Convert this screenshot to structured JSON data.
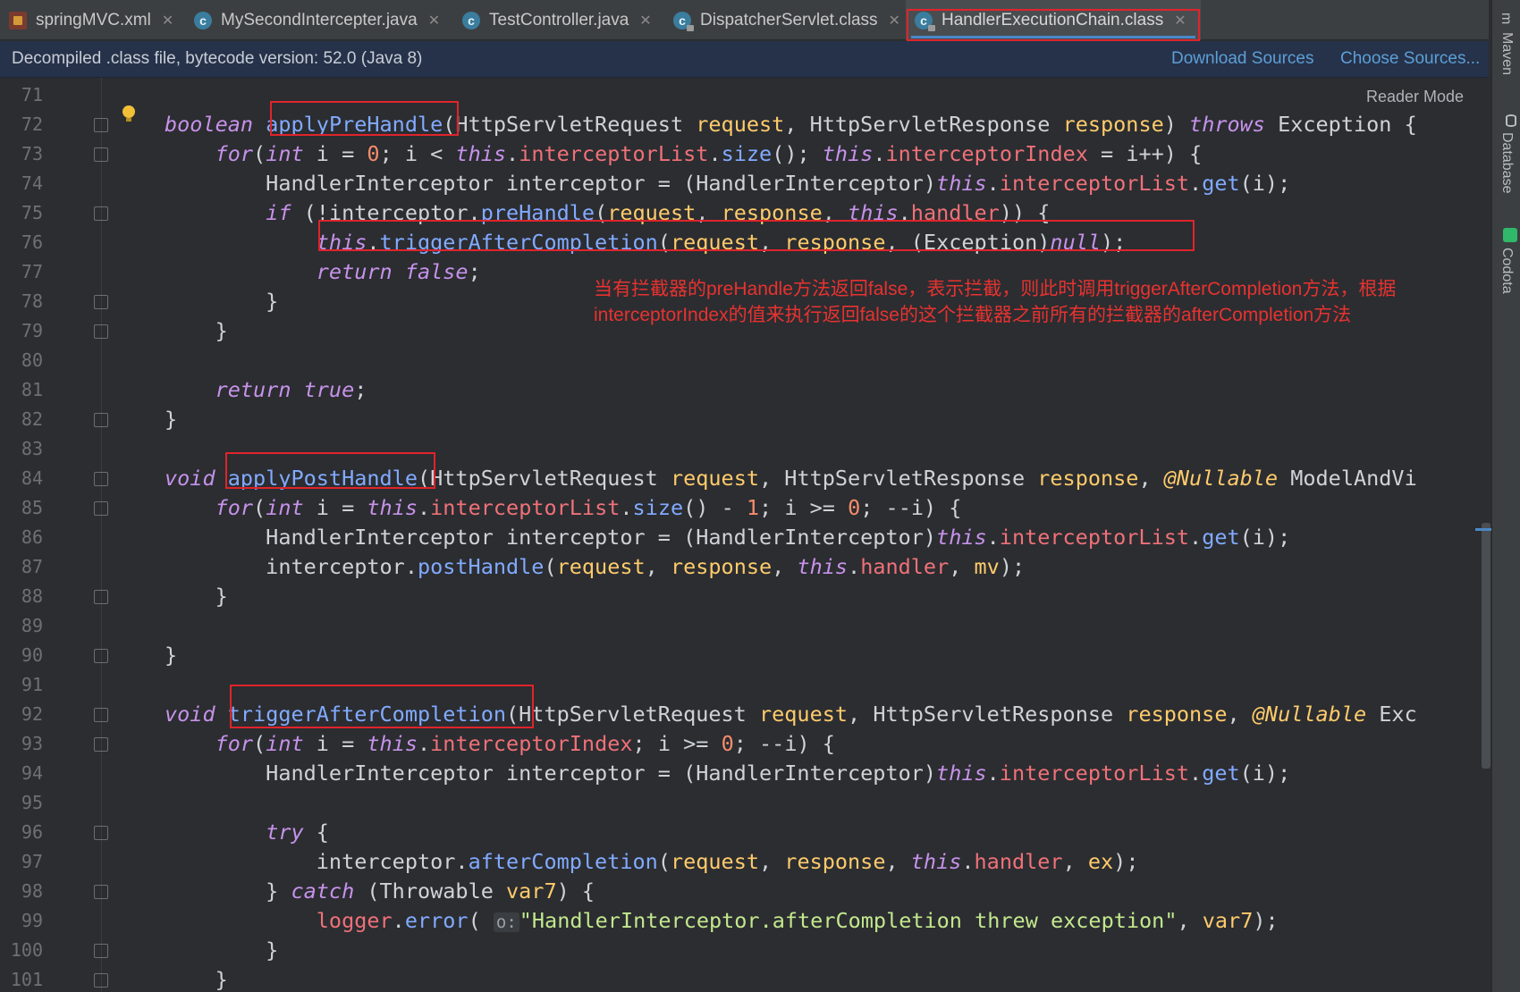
{
  "tabs": [
    {
      "label": "springMVC.xml",
      "icon": "xml-file-icon",
      "active": false
    },
    {
      "label": "MySecondIntercepter.java",
      "icon": "class-icon",
      "active": false
    },
    {
      "label": "TestController.java",
      "icon": "class-icon",
      "active": false
    },
    {
      "label": "DispatcherServlet.class",
      "icon": "locked-class-icon",
      "active": false
    },
    {
      "label": "HandlerExecutionChain.class",
      "icon": "locked-class-icon",
      "active": true
    }
  ],
  "info_bar": {
    "text": "Decompiled .class file, bytecode version: 52.0 (Java 8)",
    "download_sources": "Download Sources",
    "choose_sources": "Choose Sources..."
  },
  "reader_mode": "Reader Mode",
  "annotation_note": "当有拦截器的preHandle方法返回false，表示拦截，则此时调用triggerAfterCompletion方法，根据\ninterceptorIndex的值来执行返回false的这个拦截器之前所有的拦截器的afterCompletion方法",
  "side_panels": [
    "Maven",
    "Database",
    "Codota"
  ],
  "colors": {
    "highlight_box": "#e0242b",
    "note_text": "#e8322f",
    "link": "#5c9fd6",
    "accent": "#4a88c7"
  },
  "code_lines": [
    {
      "n": "71",
      "fold": false,
      "tokens": []
    },
    {
      "n": "72",
      "fold": true,
      "tokens": [
        [
          "kw",
          "boolean"
        ],
        [
          "p",
          " "
        ],
        [
          "fn",
          "applyPreHandle"
        ],
        [
          "p",
          "(HttpServletRequest "
        ],
        [
          "param",
          "request"
        ],
        [
          "p",
          ", HttpServletResponse "
        ],
        [
          "param",
          "response"
        ],
        [
          "p",
          ") "
        ],
        [
          "kw",
          "throws"
        ],
        [
          "p",
          " Exception {"
        ]
      ]
    },
    {
      "n": "73",
      "fold": true,
      "tokens": [
        [
          "p",
          "    "
        ],
        [
          "kw",
          "for"
        ],
        [
          "p",
          "("
        ],
        [
          "kw",
          "int"
        ],
        [
          "p",
          " i = "
        ],
        [
          "num",
          "0"
        ],
        [
          "p",
          "; i < "
        ],
        [
          "kw",
          "this"
        ],
        [
          "p",
          "."
        ],
        [
          "field",
          "interceptorList"
        ],
        [
          "p",
          "."
        ],
        [
          "fn",
          "size"
        ],
        [
          "p",
          "(); "
        ],
        [
          "kw",
          "this"
        ],
        [
          "p",
          "."
        ],
        [
          "field",
          "interceptorIndex"
        ],
        [
          "p",
          " = i++) {"
        ]
      ]
    },
    {
      "n": "74",
      "fold": false,
      "tokens": [
        [
          "p",
          "        HandlerInterceptor interceptor = (HandlerInterceptor)"
        ],
        [
          "kw",
          "this"
        ],
        [
          "p",
          "."
        ],
        [
          "field",
          "interceptorList"
        ],
        [
          "p",
          "."
        ],
        [
          "fn",
          "get"
        ],
        [
          "p",
          "(i);"
        ]
      ]
    },
    {
      "n": "75",
      "fold": true,
      "tokens": [
        [
          "p",
          "        "
        ],
        [
          "kw",
          "if"
        ],
        [
          "p",
          " (!interceptor."
        ],
        [
          "fn",
          "preHandle"
        ],
        [
          "p",
          "("
        ],
        [
          "param",
          "request"
        ],
        [
          "p",
          ", "
        ],
        [
          "param",
          "response"
        ],
        [
          "p",
          ", "
        ],
        [
          "kw",
          "this"
        ],
        [
          "p",
          "."
        ],
        [
          "field",
          "handler"
        ],
        [
          "p",
          ")) {"
        ]
      ]
    },
    {
      "n": "76",
      "fold": false,
      "tokens": [
        [
          "p",
          "            "
        ],
        [
          "kw",
          "this"
        ],
        [
          "p",
          "."
        ],
        [
          "fn",
          "triggerAfterCompletion"
        ],
        [
          "p",
          "("
        ],
        [
          "param",
          "request"
        ],
        [
          "p",
          ", "
        ],
        [
          "param",
          "response"
        ],
        [
          "p",
          ", (Exception)"
        ],
        [
          "kw",
          "null"
        ],
        [
          "p",
          ");"
        ]
      ]
    },
    {
      "n": "77",
      "fold": false,
      "tokens": [
        [
          "p",
          "            "
        ],
        [
          "kw",
          "return"
        ],
        [
          "p",
          " "
        ],
        [
          "kw",
          "false"
        ],
        [
          "p",
          ";"
        ]
      ]
    },
    {
      "n": "78",
      "fold": true,
      "tokens": [
        [
          "p",
          "        }"
        ]
      ]
    },
    {
      "n": "79",
      "fold": true,
      "tokens": [
        [
          "p",
          "    }"
        ]
      ]
    },
    {
      "n": "80",
      "fold": false,
      "tokens": []
    },
    {
      "n": "81",
      "fold": false,
      "tokens": [
        [
          "p",
          "    "
        ],
        [
          "kw",
          "return"
        ],
        [
          "p",
          " "
        ],
        [
          "kw",
          "true"
        ],
        [
          "p",
          ";"
        ]
      ]
    },
    {
      "n": "82",
      "fold": true,
      "tokens": [
        [
          "p",
          "}"
        ]
      ]
    },
    {
      "n": "83",
      "fold": false,
      "tokens": []
    },
    {
      "n": "84",
      "fold": true,
      "tokens": [
        [
          "kw",
          "void"
        ],
        [
          "p",
          " "
        ],
        [
          "fn",
          "applyPostHandle"
        ],
        [
          "p",
          "(HttpServletRequest "
        ],
        [
          "param",
          "request"
        ],
        [
          "p",
          ", HttpServletResponse "
        ],
        [
          "param",
          "response"
        ],
        [
          "p",
          ", "
        ],
        [
          "ann",
          "@Nullable"
        ],
        [
          "p",
          " ModelAndVi"
        ]
      ]
    },
    {
      "n": "85",
      "fold": true,
      "tokens": [
        [
          "p",
          "    "
        ],
        [
          "kw",
          "for"
        ],
        [
          "p",
          "("
        ],
        [
          "kw",
          "int"
        ],
        [
          "p",
          " i = "
        ],
        [
          "kw",
          "this"
        ],
        [
          "p",
          "."
        ],
        [
          "field",
          "interceptorList"
        ],
        [
          "p",
          "."
        ],
        [
          "fn",
          "size"
        ],
        [
          "p",
          "() - "
        ],
        [
          "num",
          "1"
        ],
        [
          "p",
          "; i >= "
        ],
        [
          "num",
          "0"
        ],
        [
          "p",
          "; --i) {"
        ]
      ]
    },
    {
      "n": "86",
      "fold": false,
      "tokens": [
        [
          "p",
          "        HandlerInterceptor interceptor = (HandlerInterceptor)"
        ],
        [
          "kw",
          "this"
        ],
        [
          "p",
          "."
        ],
        [
          "field",
          "interceptorList"
        ],
        [
          "p",
          "."
        ],
        [
          "fn",
          "get"
        ],
        [
          "p",
          "(i);"
        ]
      ]
    },
    {
      "n": "87",
      "fold": false,
      "tokens": [
        [
          "p",
          "        interceptor."
        ],
        [
          "fn",
          "postHandle"
        ],
        [
          "p",
          "("
        ],
        [
          "param",
          "request"
        ],
        [
          "p",
          ", "
        ],
        [
          "param",
          "response"
        ],
        [
          "p",
          ", "
        ],
        [
          "kw",
          "this"
        ],
        [
          "p",
          "."
        ],
        [
          "field",
          "handler"
        ],
        [
          "p",
          ", "
        ],
        [
          "param",
          "mv"
        ],
        [
          "p",
          ");"
        ]
      ]
    },
    {
      "n": "88",
      "fold": true,
      "tokens": [
        [
          "p",
          "    }"
        ]
      ]
    },
    {
      "n": "89",
      "fold": false,
      "tokens": []
    },
    {
      "n": "90",
      "fold": true,
      "tokens": [
        [
          "p",
          "}"
        ]
      ]
    },
    {
      "n": "91",
      "fold": false,
      "tokens": []
    },
    {
      "n": "92",
      "fold": true,
      "tokens": [
        [
          "kw",
          "void"
        ],
        [
          "p",
          " "
        ],
        [
          "fn",
          "triggerAfterCompletion"
        ],
        [
          "p",
          "(HttpServletRequest "
        ],
        [
          "param",
          "request"
        ],
        [
          "p",
          ", HttpServletResponse "
        ],
        [
          "param",
          "response"
        ],
        [
          "p",
          ", "
        ],
        [
          "ann",
          "@Nullable"
        ],
        [
          "p",
          " Exc"
        ]
      ]
    },
    {
      "n": "93",
      "fold": true,
      "tokens": [
        [
          "p",
          "    "
        ],
        [
          "kw",
          "for"
        ],
        [
          "p",
          "("
        ],
        [
          "kw",
          "int"
        ],
        [
          "p",
          " i = "
        ],
        [
          "kw",
          "this"
        ],
        [
          "p",
          "."
        ],
        [
          "field",
          "interceptorIndex"
        ],
        [
          "p",
          "; i >= "
        ],
        [
          "num",
          "0"
        ],
        [
          "p",
          "; --i) {"
        ]
      ]
    },
    {
      "n": "94",
      "fold": false,
      "tokens": [
        [
          "p",
          "        HandlerInterceptor interceptor = (HandlerInterceptor)"
        ],
        [
          "kw",
          "this"
        ],
        [
          "p",
          "."
        ],
        [
          "field",
          "interceptorList"
        ],
        [
          "p",
          "."
        ],
        [
          "fn",
          "get"
        ],
        [
          "p",
          "(i);"
        ]
      ]
    },
    {
      "n": "95",
      "fold": false,
      "tokens": []
    },
    {
      "n": "96",
      "fold": true,
      "tokens": [
        [
          "p",
          "        "
        ],
        [
          "kw",
          "try"
        ],
        [
          "p",
          " {"
        ]
      ]
    },
    {
      "n": "97",
      "fold": false,
      "tokens": [
        [
          "p",
          "            interceptor."
        ],
        [
          "fn",
          "afterCompletion"
        ],
        [
          "p",
          "("
        ],
        [
          "param",
          "request"
        ],
        [
          "p",
          ", "
        ],
        [
          "param",
          "response"
        ],
        [
          "p",
          ", "
        ],
        [
          "kw",
          "this"
        ],
        [
          "p",
          "."
        ],
        [
          "field",
          "handler"
        ],
        [
          "p",
          ", "
        ],
        [
          "param",
          "ex"
        ],
        [
          "p",
          ");"
        ]
      ]
    },
    {
      "n": "98",
      "fold": true,
      "tokens": [
        [
          "p",
          "        } "
        ],
        [
          "kw",
          "catch"
        ],
        [
          "p",
          " (Throwable "
        ],
        [
          "param",
          "var7"
        ],
        [
          "p",
          ") {"
        ]
      ]
    },
    {
      "n": "99",
      "fold": false,
      "tokens": [
        [
          "p",
          "            "
        ],
        [
          "field",
          "logger"
        ],
        [
          "p",
          "."
        ],
        [
          "fn",
          "error"
        ],
        [
          "p",
          "( "
        ],
        [
          "hint",
          "o:"
        ],
        [
          "str",
          "\"HandlerInterceptor.afterCompletion threw exception\""
        ],
        [
          "p",
          ", "
        ],
        [
          "param",
          "var7"
        ],
        [
          "p",
          ");"
        ]
      ]
    },
    {
      "n": "100",
      "fold": true,
      "tokens": [
        [
          "p",
          "        }"
        ]
      ]
    },
    {
      "n": "101",
      "fold": true,
      "tokens": [
        [
          "p",
          "    }"
        ]
      ]
    }
  ]
}
